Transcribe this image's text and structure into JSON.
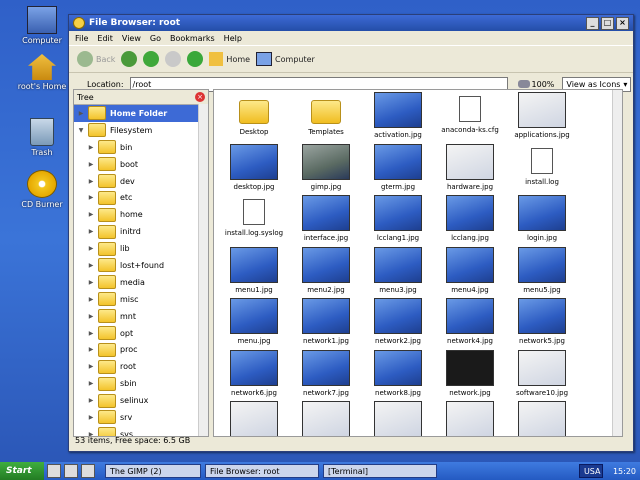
{
  "desktop": {
    "icons": [
      {
        "label": "Computer"
      },
      {
        "label": "root's Home"
      },
      {
        "label": "Trash"
      },
      {
        "label": "CD Burner"
      }
    ]
  },
  "window": {
    "title": "File Browser: root",
    "menu": [
      "File",
      "Edit",
      "View",
      "Go",
      "Bookmarks",
      "Help"
    ],
    "toolbar": {
      "back": "Back",
      "home": "Home",
      "computer": "Computer"
    },
    "location_label": "Location:",
    "location_value": "/root",
    "zoom": "100%",
    "view_mode": "View as Icons",
    "sidebar_title": "Tree",
    "tree": [
      {
        "label": "Home Folder",
        "selected": true
      },
      {
        "label": "Filesystem"
      },
      {
        "label": "bin"
      },
      {
        "label": "boot"
      },
      {
        "label": "dev"
      },
      {
        "label": "etc"
      },
      {
        "label": "home"
      },
      {
        "label": "initrd"
      },
      {
        "label": "lib"
      },
      {
        "label": "lost+found"
      },
      {
        "label": "media"
      },
      {
        "label": "misc"
      },
      {
        "label": "mnt"
      },
      {
        "label": "opt"
      },
      {
        "label": "proc"
      },
      {
        "label": "root"
      },
      {
        "label": "sbin"
      },
      {
        "label": "selinux"
      },
      {
        "label": "srv"
      },
      {
        "label": "sys"
      }
    ],
    "files": [
      {
        "name": "Desktop",
        "kind": "folder"
      },
      {
        "name": "Templates",
        "kind": "folder"
      },
      {
        "name": "activation.jpg",
        "kind": "thumb"
      },
      {
        "name": "anaconda-ks.cfg",
        "kind": "doc"
      },
      {
        "name": "applications.jpg",
        "kind": "light"
      },
      {
        "name": "desktop.jpg",
        "kind": "thumb"
      },
      {
        "name": "gimp.jpg",
        "kind": "photo"
      },
      {
        "name": "gterm.jpg",
        "kind": "thumb"
      },
      {
        "name": "hardware.jpg",
        "kind": "light"
      },
      {
        "name": "install.log",
        "kind": "doc"
      },
      {
        "name": "install.log.syslog",
        "kind": "doc"
      },
      {
        "name": "interface.jpg",
        "kind": "thumb"
      },
      {
        "name": "lcclang1.jpg",
        "kind": "thumb"
      },
      {
        "name": "lcclang.jpg",
        "kind": "thumb"
      },
      {
        "name": "login.jpg",
        "kind": "thumb"
      },
      {
        "name": "menu1.jpg",
        "kind": "thumb"
      },
      {
        "name": "menu2.jpg",
        "kind": "thumb"
      },
      {
        "name": "menu3.jpg",
        "kind": "thumb"
      },
      {
        "name": "menu4.jpg",
        "kind": "thumb"
      },
      {
        "name": "menu5.jpg",
        "kind": "thumb"
      },
      {
        "name": "menu.jpg",
        "kind": "thumb"
      },
      {
        "name": "network1.jpg",
        "kind": "thumb"
      },
      {
        "name": "network2.jpg",
        "kind": "thumb"
      },
      {
        "name": "network4.jpg",
        "kind": "thumb"
      },
      {
        "name": "network5.jpg",
        "kind": "thumb"
      },
      {
        "name": "network6.jpg",
        "kind": "thumb"
      },
      {
        "name": "network7.jpg",
        "kind": "thumb"
      },
      {
        "name": "network8.jpg",
        "kind": "thumb"
      },
      {
        "name": "network.jpg",
        "kind": "dark"
      },
      {
        "name": "software10.jpg",
        "kind": "light"
      },
      {
        "name": "",
        "kind": "light"
      },
      {
        "name": "",
        "kind": "light"
      },
      {
        "name": "",
        "kind": "light"
      },
      {
        "name": "",
        "kind": "light"
      },
      {
        "name": "",
        "kind": "light"
      }
    ],
    "status": "53 items, Free space: 6.5 GB"
  },
  "taskbar": {
    "start": "Start",
    "tasks": [
      "The GIMP (2)",
      "File Browser: root",
      "[Terminal]"
    ],
    "clock": "15:20",
    "lang": "USA"
  }
}
